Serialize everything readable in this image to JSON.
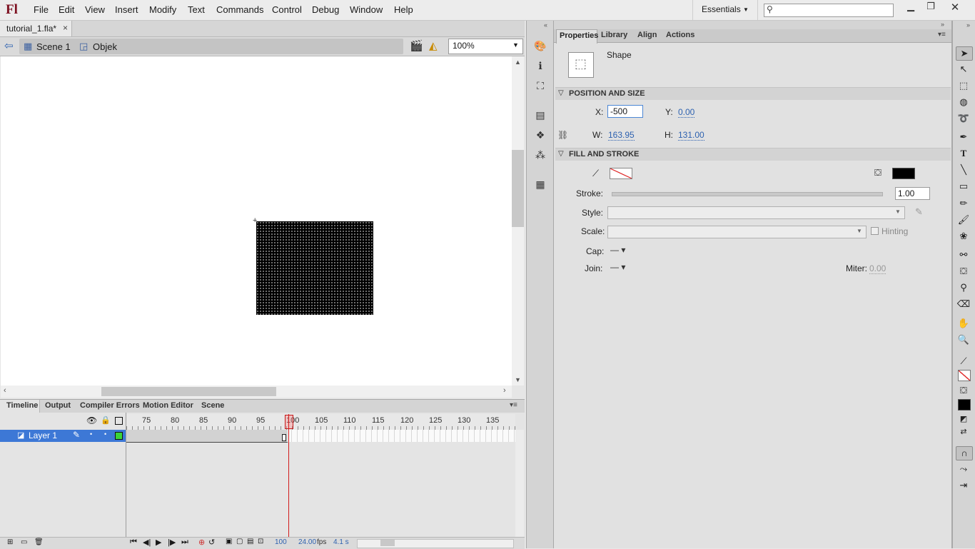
{
  "app": {
    "logo": "Fl"
  },
  "menu": [
    "File",
    "Edit",
    "View",
    "Insert",
    "Modify",
    "Text",
    "Commands",
    "Control",
    "Debug",
    "Window",
    "Help"
  ],
  "workspace": {
    "label": "Essentials"
  },
  "search": {
    "placeholder": ""
  },
  "document": {
    "tab": "tutorial_1.fla*"
  },
  "breadcrumb": {
    "scene": "Scene 1",
    "object": "Objek"
  },
  "zoom": {
    "value": "100%"
  },
  "timeline": {
    "tabs": [
      "Timeline",
      "Output",
      "Compiler Errors",
      "Motion Editor",
      "Scene"
    ],
    "ruler": [
      "75",
      "80",
      "85",
      "90",
      "95",
      "100",
      "105",
      "110",
      "115",
      "120",
      "125",
      "130",
      "135"
    ],
    "layer": "Layer 1",
    "frame": "100",
    "fps": "24.00",
    "fps_unit": "fps",
    "time": "4.1 s"
  },
  "properties": {
    "tabs": [
      "Properties",
      "Library",
      "Align",
      "Actions"
    ],
    "object_type": "Shape",
    "position_size": {
      "title": "POSITION AND SIZE",
      "x_label": "X:",
      "x_value": "-500",
      "y_label": "Y:",
      "y_value": "0.00",
      "w_label": "W:",
      "w_value": "163.95",
      "h_label": "H:",
      "h_value": "131.00"
    },
    "fill_stroke": {
      "title": "FILL AND STROKE",
      "stroke_label": "Stroke:",
      "stroke_value": "1.00",
      "style_label": "Style:",
      "scale_label": "Scale:",
      "hinting_label": "Hinting",
      "cap_label": "Cap:",
      "join_label": "Join:",
      "miter_label": "Miter:",
      "miter_value": "0.00",
      "stroke_color": "#ffffff",
      "fill_color": "#000000"
    }
  },
  "colors": {
    "accent": "#3d78d6",
    "playhead": "#d21c1c",
    "link": "#2e62b0"
  }
}
